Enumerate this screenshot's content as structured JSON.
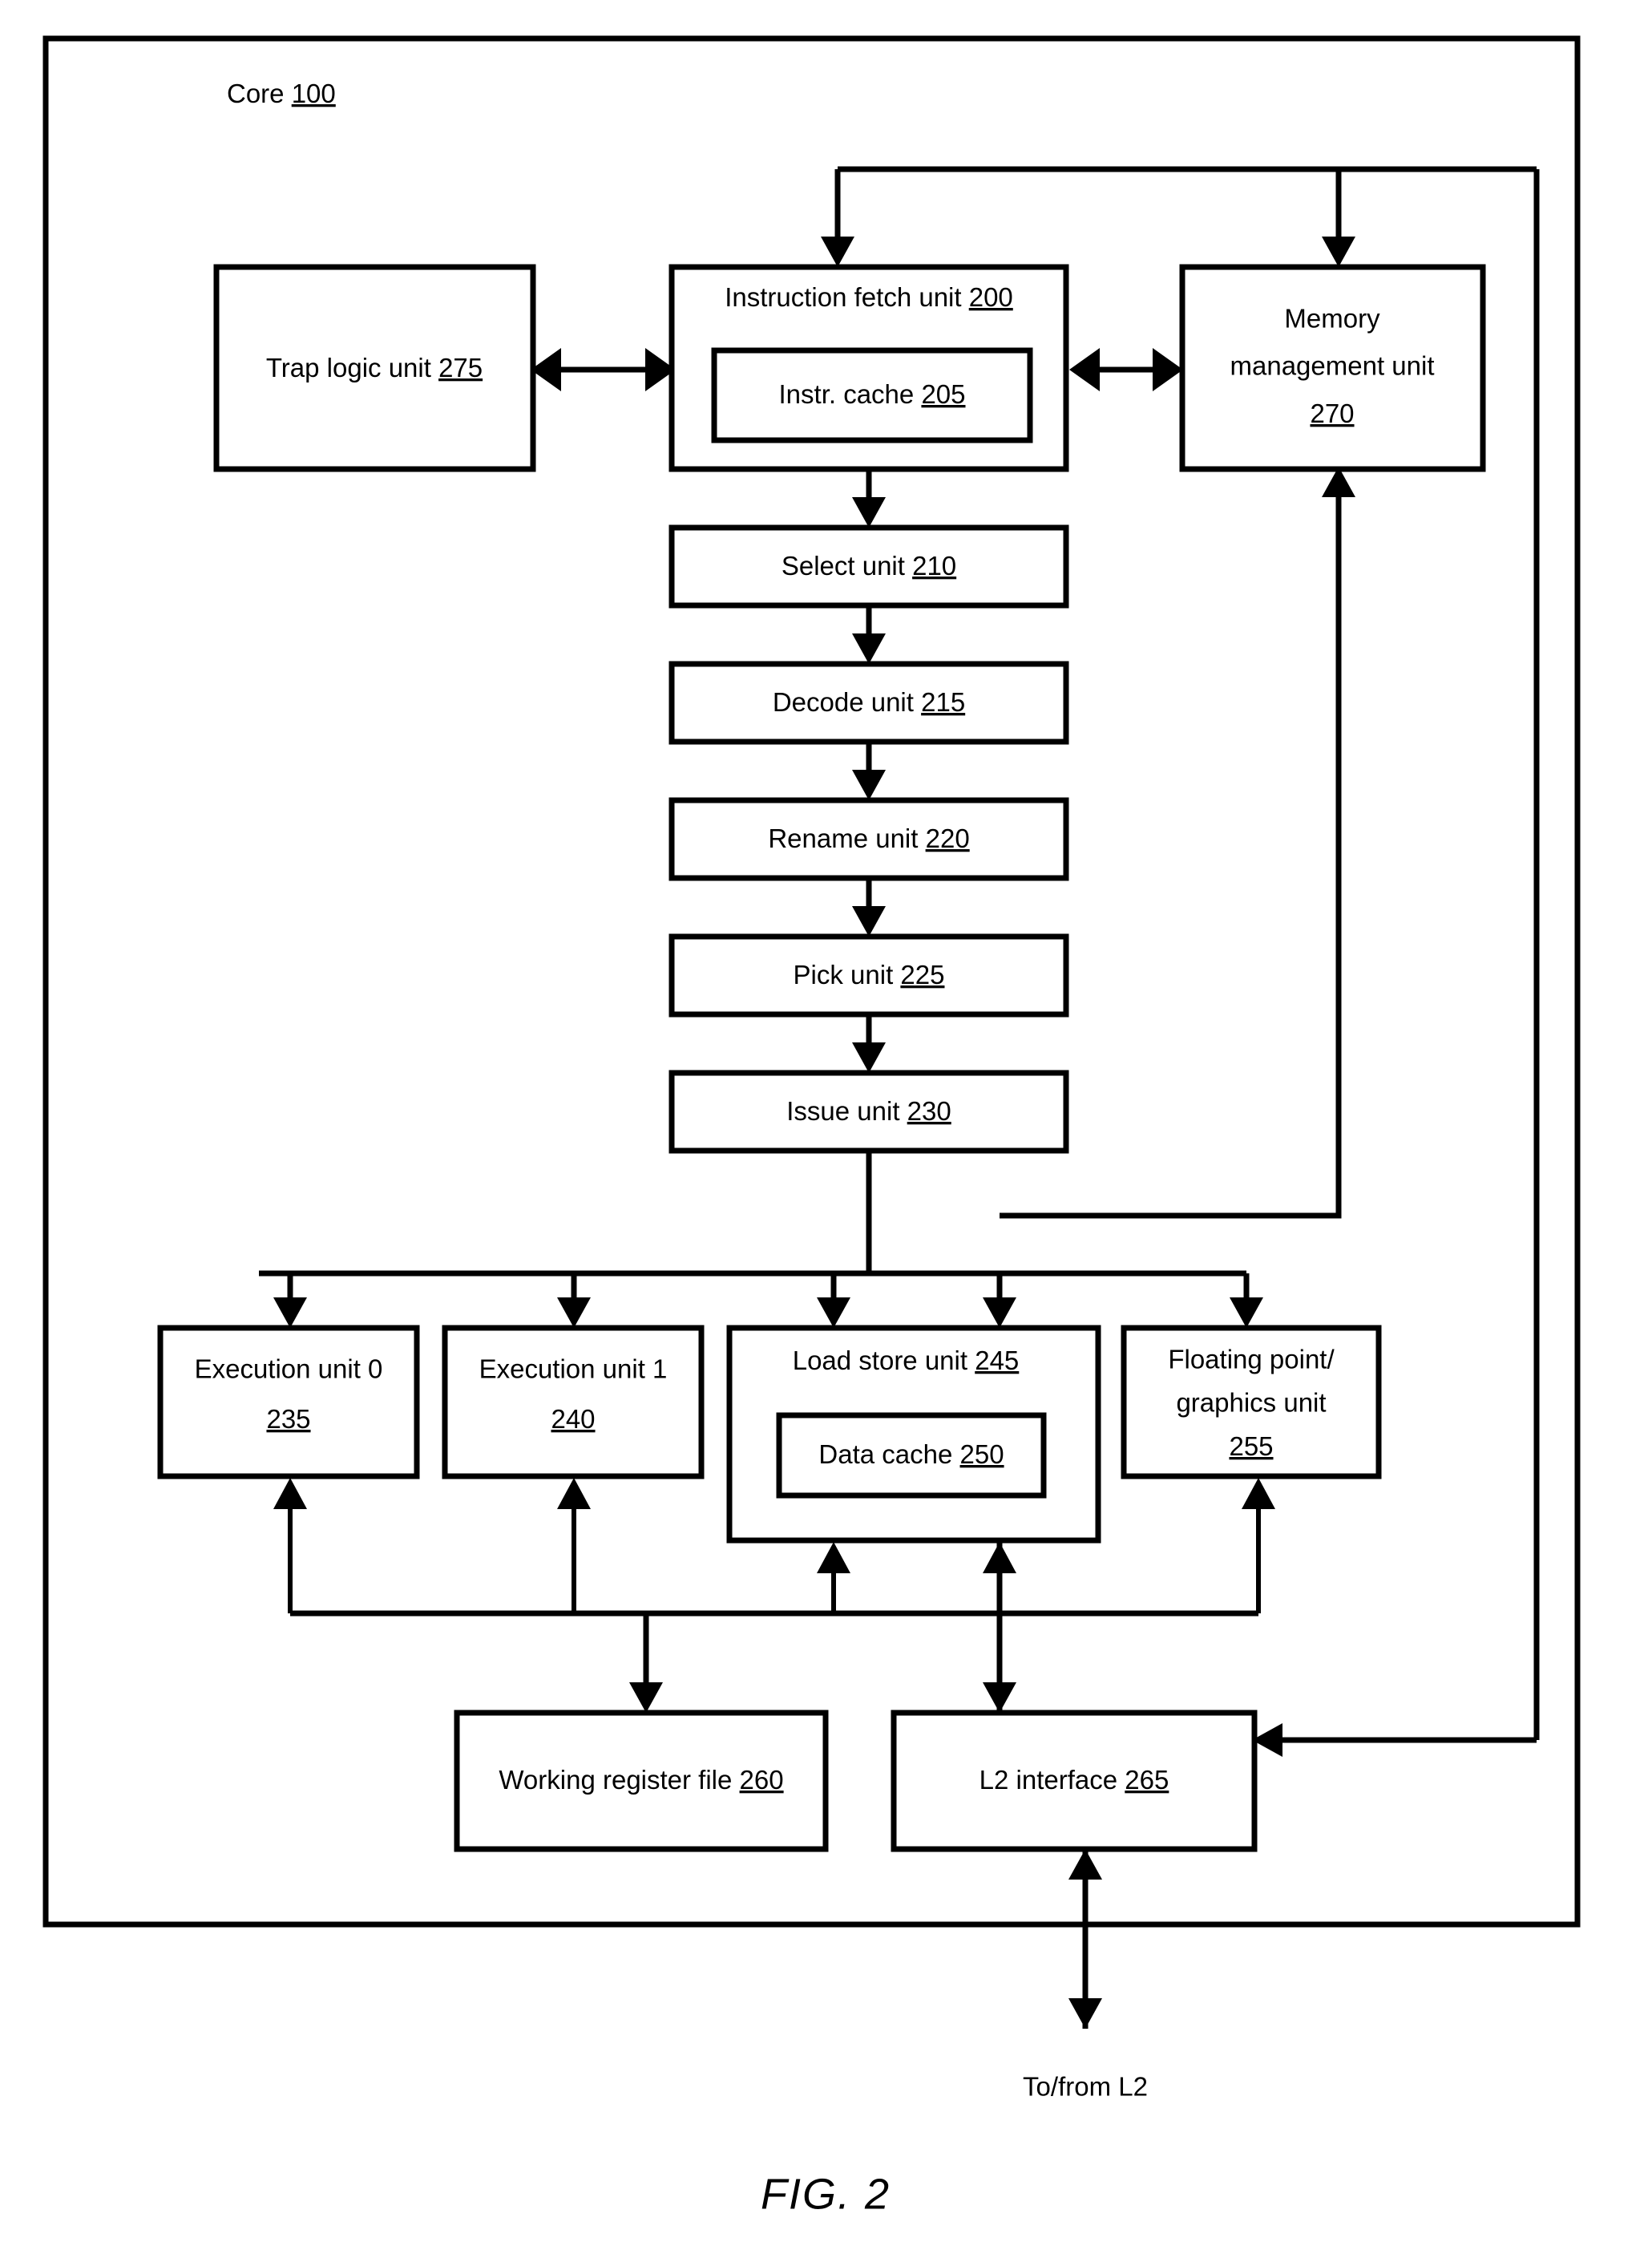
{
  "figure": {
    "caption": "FIG. 2",
    "core_label": "Core",
    "core_ref": "100",
    "external_label": "To/from L2"
  },
  "blocks": [
    {
      "id": "trap-logic-unit",
      "label": "Trap logic unit",
      "ref": "275"
    },
    {
      "id": "instruction-fetch-unit",
      "label": "Instruction fetch unit",
      "ref": "200"
    },
    {
      "id": "instr-cache",
      "label": "Instr. cache",
      "ref": "205"
    },
    {
      "id": "memory-management-unit",
      "label_line1": "Memory",
      "label_line2": "management unit",
      "ref": "270"
    },
    {
      "id": "select-unit",
      "label": "Select unit",
      "ref": "210"
    },
    {
      "id": "decode-unit",
      "label": "Decode unit",
      "ref": "215"
    },
    {
      "id": "rename-unit",
      "label": "Rename unit",
      "ref": "220"
    },
    {
      "id": "pick-unit",
      "label": "Pick unit",
      "ref": "225"
    },
    {
      "id": "issue-unit",
      "label": "Issue unit",
      "ref": "230"
    },
    {
      "id": "execution-unit-0",
      "label": "Execution unit 0",
      "ref": "235"
    },
    {
      "id": "execution-unit-1",
      "label": "Execution unit 1",
      "ref": "240"
    },
    {
      "id": "load-store-unit",
      "label": "Load store unit",
      "ref": "245"
    },
    {
      "id": "data-cache",
      "label": "Data cache",
      "ref": "250"
    },
    {
      "id": "floating-point-graphics-unit",
      "label_line1": "Floating point/",
      "label_line2": "graphics unit",
      "ref": "255"
    },
    {
      "id": "working-register-file",
      "label": "Working register file",
      "ref": "260"
    },
    {
      "id": "l2-interface",
      "label": "L2 interface",
      "ref": "265"
    }
  ],
  "text": {
    "core": "Core",
    "core_ref": "100",
    "trap_logic_unit": "Trap logic unit",
    "trap_logic_unit_ref": "275",
    "instruction_fetch_unit": "Instruction fetch unit",
    "instruction_fetch_unit_ref": "200",
    "instr_cache": "Instr. cache",
    "instr_cache_ref": "205",
    "mmu_line1": "Memory",
    "mmu_line2": "management unit",
    "mmu_ref": "270",
    "select_unit": "Select unit",
    "select_unit_ref": "210",
    "decode_unit": "Decode unit",
    "decode_unit_ref": "215",
    "rename_unit": "Rename unit",
    "rename_unit_ref": "220",
    "pick_unit": "Pick unit",
    "pick_unit_ref": "225",
    "issue_unit": "Issue unit",
    "issue_unit_ref": "230",
    "execution_unit_0": "Execution unit 0",
    "execution_unit_0_ref": "235",
    "execution_unit_1": "Execution unit 1",
    "execution_unit_1_ref": "240",
    "load_store_unit": "Load store unit",
    "load_store_unit_ref": "245",
    "data_cache": "Data cache",
    "data_cache_ref": "250",
    "fgu_line1": "Floating point/",
    "fgu_line2": "graphics unit",
    "fgu_ref": "255",
    "working_register_file": "Working register file",
    "working_register_file_ref": "260",
    "l2_interface": "L2 interface",
    "l2_interface_ref": "265",
    "to_from_l2": "To/from L2",
    "fig_caption": "FIG. 2"
  },
  "colors": {
    "stroke": "#000000",
    "background": "#ffffff"
  }
}
